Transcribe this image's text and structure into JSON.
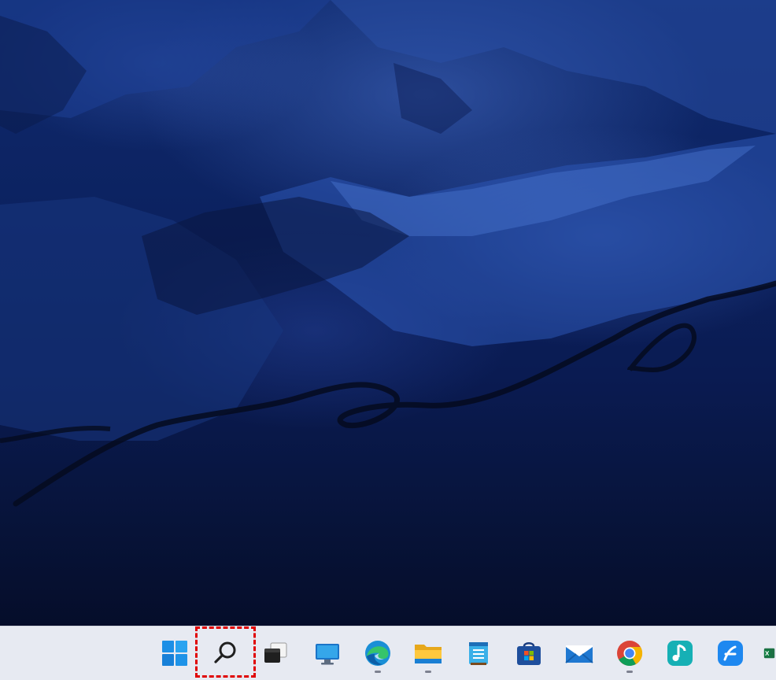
{
  "desktop": {
    "wallpaper": "snowy-mountain-night",
    "accent_color": "#0c2260"
  },
  "taskbar": {
    "background": "#e7eaf2",
    "items": [
      {
        "name": "start",
        "icon": "windows-logo-icon",
        "running": false
      },
      {
        "name": "search",
        "icon": "search-icon",
        "running": false,
        "highlighted": true
      },
      {
        "name": "task-view",
        "icon": "task-view-icon",
        "running": false
      },
      {
        "name": "remote-desktop",
        "icon": "monitor-icon",
        "running": false
      },
      {
        "name": "edge",
        "icon": "edge-icon",
        "running": true
      },
      {
        "name": "file-explorer",
        "icon": "folder-icon",
        "running": true
      },
      {
        "name": "notepad",
        "icon": "notepad-icon",
        "running": false
      },
      {
        "name": "microsoft-store",
        "icon": "store-icon",
        "running": false
      },
      {
        "name": "mail",
        "icon": "mail-icon",
        "running": false
      },
      {
        "name": "chrome",
        "icon": "chrome-icon",
        "running": true
      },
      {
        "name": "music-app",
        "icon": "music-note-icon",
        "running": false
      },
      {
        "name": "app-f",
        "icon": "blue-app-icon",
        "running": false
      },
      {
        "name": "excel",
        "icon": "excel-icon",
        "running": false
      }
    ],
    "highlight_color": "#e00000"
  }
}
